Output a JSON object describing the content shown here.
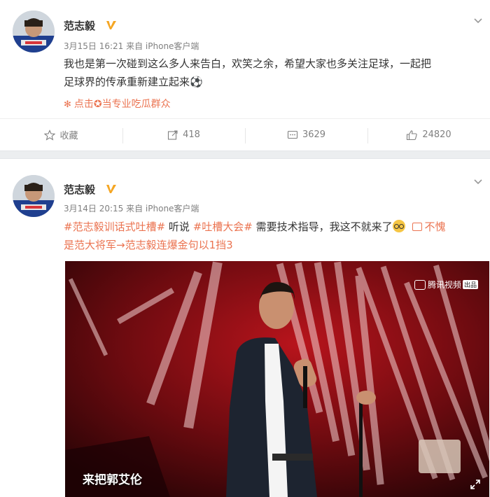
{
  "posts": [
    {
      "author": "范志毅",
      "meta": "3月15日 16:21 来自 iPhone客户端",
      "text_line1": "我也是第一次碰到这么多人来告白，欢笑之余，希望大家也多关注足球，一起把",
      "text_line2": "足球界的传承重新建立起来",
      "emoji": "⚽",
      "extra_link": "点击✪当专业吃瓜群众",
      "actions": {
        "favorite": "收藏",
        "repost": "418",
        "comment": "3629",
        "like": "24820"
      }
    },
    {
      "author": "范志毅",
      "meta": "3月14日 20:15 来自 iPhone客户端",
      "hashtag1": "#范志毅训话式吐槽#",
      "text_a": "听说",
      "hashtag2": "#吐槽大会#",
      "text_b": "需要技术指导，我这不就来了",
      "link1": "不愧",
      "link2": "是范大将军→范志毅连爆金句以1挡3",
      "video": {
        "logo": "腾讯视频",
        "logo_badge": "出品",
        "caption": "来把郭艾伦"
      }
    }
  ],
  "colors": {
    "accent": "#eb7350",
    "meta": "#808080",
    "badge": "#f5a623"
  }
}
